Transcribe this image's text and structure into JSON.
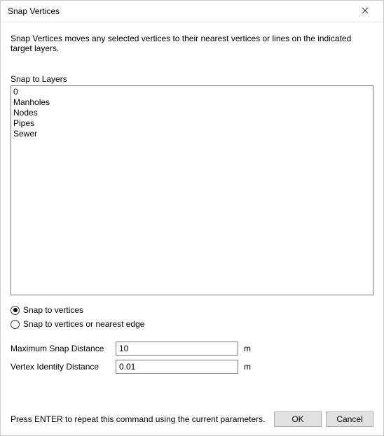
{
  "window": {
    "title": "Snap Vertices"
  },
  "description": "Snap Vertices moves any selected vertices to their nearest vertices or lines on the indicated target layers.",
  "layers": {
    "label": "Snap to Layers",
    "items": [
      {
        "label": "0"
      },
      {
        "label": "Manholes"
      },
      {
        "label": "Nodes"
      },
      {
        "label": "Pipes"
      },
      {
        "label": "Sewer"
      }
    ]
  },
  "snapMode": {
    "selected": "vertices",
    "options": {
      "vertices": "Snap to vertices",
      "nearestEdge": "Snap to vertices or nearest edge"
    }
  },
  "params": {
    "maxSnap": {
      "label": "Maximum Snap Distance",
      "value": "10",
      "unit": "m"
    },
    "vertexIdentity": {
      "label": "Vertex Identity Distance",
      "value": "0.01",
      "unit": "m"
    }
  },
  "footer": {
    "hint": "Press ENTER to repeat this command using the current parameters.",
    "ok": "OK",
    "cancel": "Cancel"
  }
}
